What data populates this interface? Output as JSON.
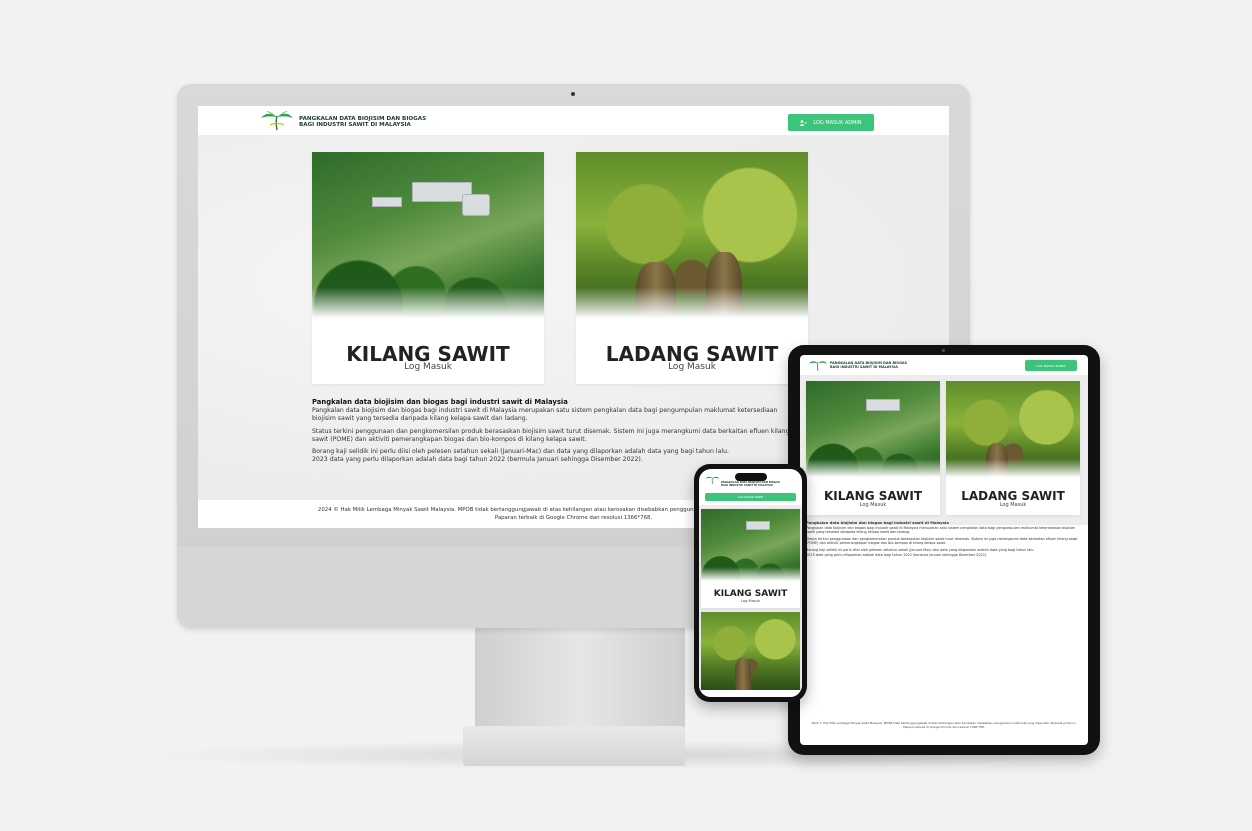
{
  "site": {
    "title_line1": "PANGKALAN DATA BIOJISIM DAN BIOGAS",
    "title_line2": "BAGI INDUSTRI SAWIT DI MALAYSIA",
    "admin_button": "LOG MASUK ADMIN"
  },
  "cards": [
    {
      "title": "KILANG SAWIT",
      "subtitle": "Log Masuk"
    },
    {
      "title": "LADANG SAWIT",
      "subtitle": "Log Masuk"
    }
  ],
  "description": {
    "heading": "Pangkalan data biojisim dan biogas bagi industri sawit di Malaysia",
    "p1": "Pangkalan data biojisim dan biogas bagi industri sawit di Malaysia merupakan satu sistem pengkalan data bagi pengumpulan maklumat ketersediaan biojisim sawit yang tersedia daripada kilang kelapa sawit dan ladang.",
    "p2": "Status terkini penggunaan dan pengkomersilan produk berasaskan biojisim sawit turut disemak. Sistem ini juga merangkumi data berkaitan efluen kilang sawit (POME) dan aktiviti pemerangkapan biogas dan bio-kompos di kilang kelapa sawit.",
    "p3": "Borang kaji selidik ini perlu diisi oleh pelesen setahun sekali (Januari-Mac) dan data yang dilaporkan adalah data yang bagi tahun lalu.",
    "p4": "2023 data yang perlu dilaporkan adalah data bagi tahun 2022 (bermula Januari sehingga Disember 2022)."
  },
  "footer": {
    "line1": "2024 © Hak Milik Lembaga Minyak Sawit Malaysia. MPOB tidak bertanggungjawab di atas kehilangan atau kerosakan disebabkan penggunaan maklumat yang diperolehi daripada portal ini.",
    "line2": "Paparan terbaik di Google Chrome dan resolusi 1366*768."
  },
  "colors": {
    "accent": "#3cc47a",
    "brand_dark": "#1d3b2a"
  },
  "icons": {
    "logo": "palm-leaf-logo-icon",
    "admin": "user-key-icon"
  }
}
